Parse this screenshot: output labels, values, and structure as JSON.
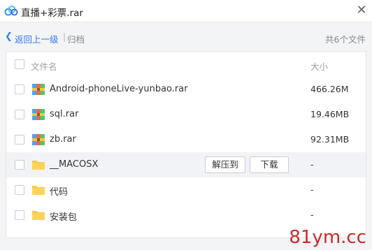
{
  "window": {
    "title": "直播+彩票.rar"
  },
  "nav": {
    "back_label": "返回上一级",
    "separator": "|",
    "crumb": "归档",
    "count_label": "共6个文件"
  },
  "table": {
    "header_name": "文件名",
    "header_size": "大小",
    "rows": [
      {
        "name": "Android-phoneLive-yunbao.rar",
        "size": "466.26M",
        "type": "archive"
      },
      {
        "name": "sql.rar",
        "size": "19.46MB",
        "type": "archive"
      },
      {
        "name": "zb.rar",
        "size": "92.31MB",
        "type": "archive"
      },
      {
        "name": "__MACOSX",
        "size": "-",
        "type": "folder",
        "highlighted": true
      },
      {
        "name": "代码",
        "size": "-",
        "type": "folder"
      },
      {
        "name": "安装包",
        "size": "-",
        "type": "folder"
      }
    ]
  },
  "actions": {
    "extract_label": "解压到",
    "download_label": "下载"
  },
  "watermark": "81ym.cc",
  "icons": {
    "app": "cloud-icon",
    "close": "close-icon",
    "back": "chevron-left-icon",
    "archive": "archive-file-icon",
    "folder": "folder-icon"
  },
  "colors": {
    "accent": "#3478f6",
    "folder": "#f7c844",
    "watermark": "#cc2a2a"
  }
}
